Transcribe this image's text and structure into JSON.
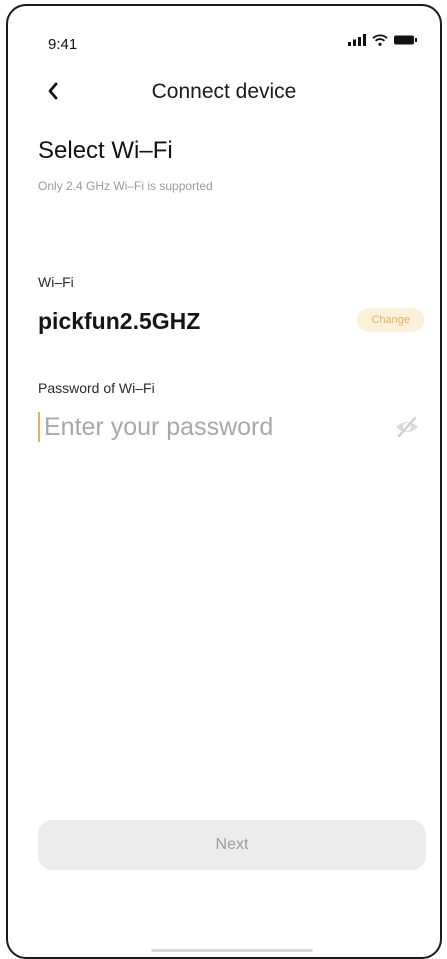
{
  "status_bar": {
    "time": "9:41",
    "icons": [
      "signal-icon",
      "wifi-icon",
      "battery-icon"
    ]
  },
  "nav": {
    "back_icon": "chevron-left-icon",
    "title": "Connect device"
  },
  "section": {
    "heading": "Select Wi–Fi",
    "subheading": "Only 2.4 GHz Wi–Fi is supported"
  },
  "wifi": {
    "label": "Wi–Fi",
    "name": "pickfun2.5GHZ",
    "change_label": "Change"
  },
  "password": {
    "label": "Password of Wi–Fi",
    "value": "",
    "placeholder": "Enter your password",
    "visibility_icon": "eye-slash-icon"
  },
  "footer": {
    "next_label": "Next"
  },
  "colors": {
    "accent": "#e5b35c",
    "change_bg": "#fbf1da",
    "button_bg": "#ececec",
    "muted_text": "#9a9a9a"
  }
}
